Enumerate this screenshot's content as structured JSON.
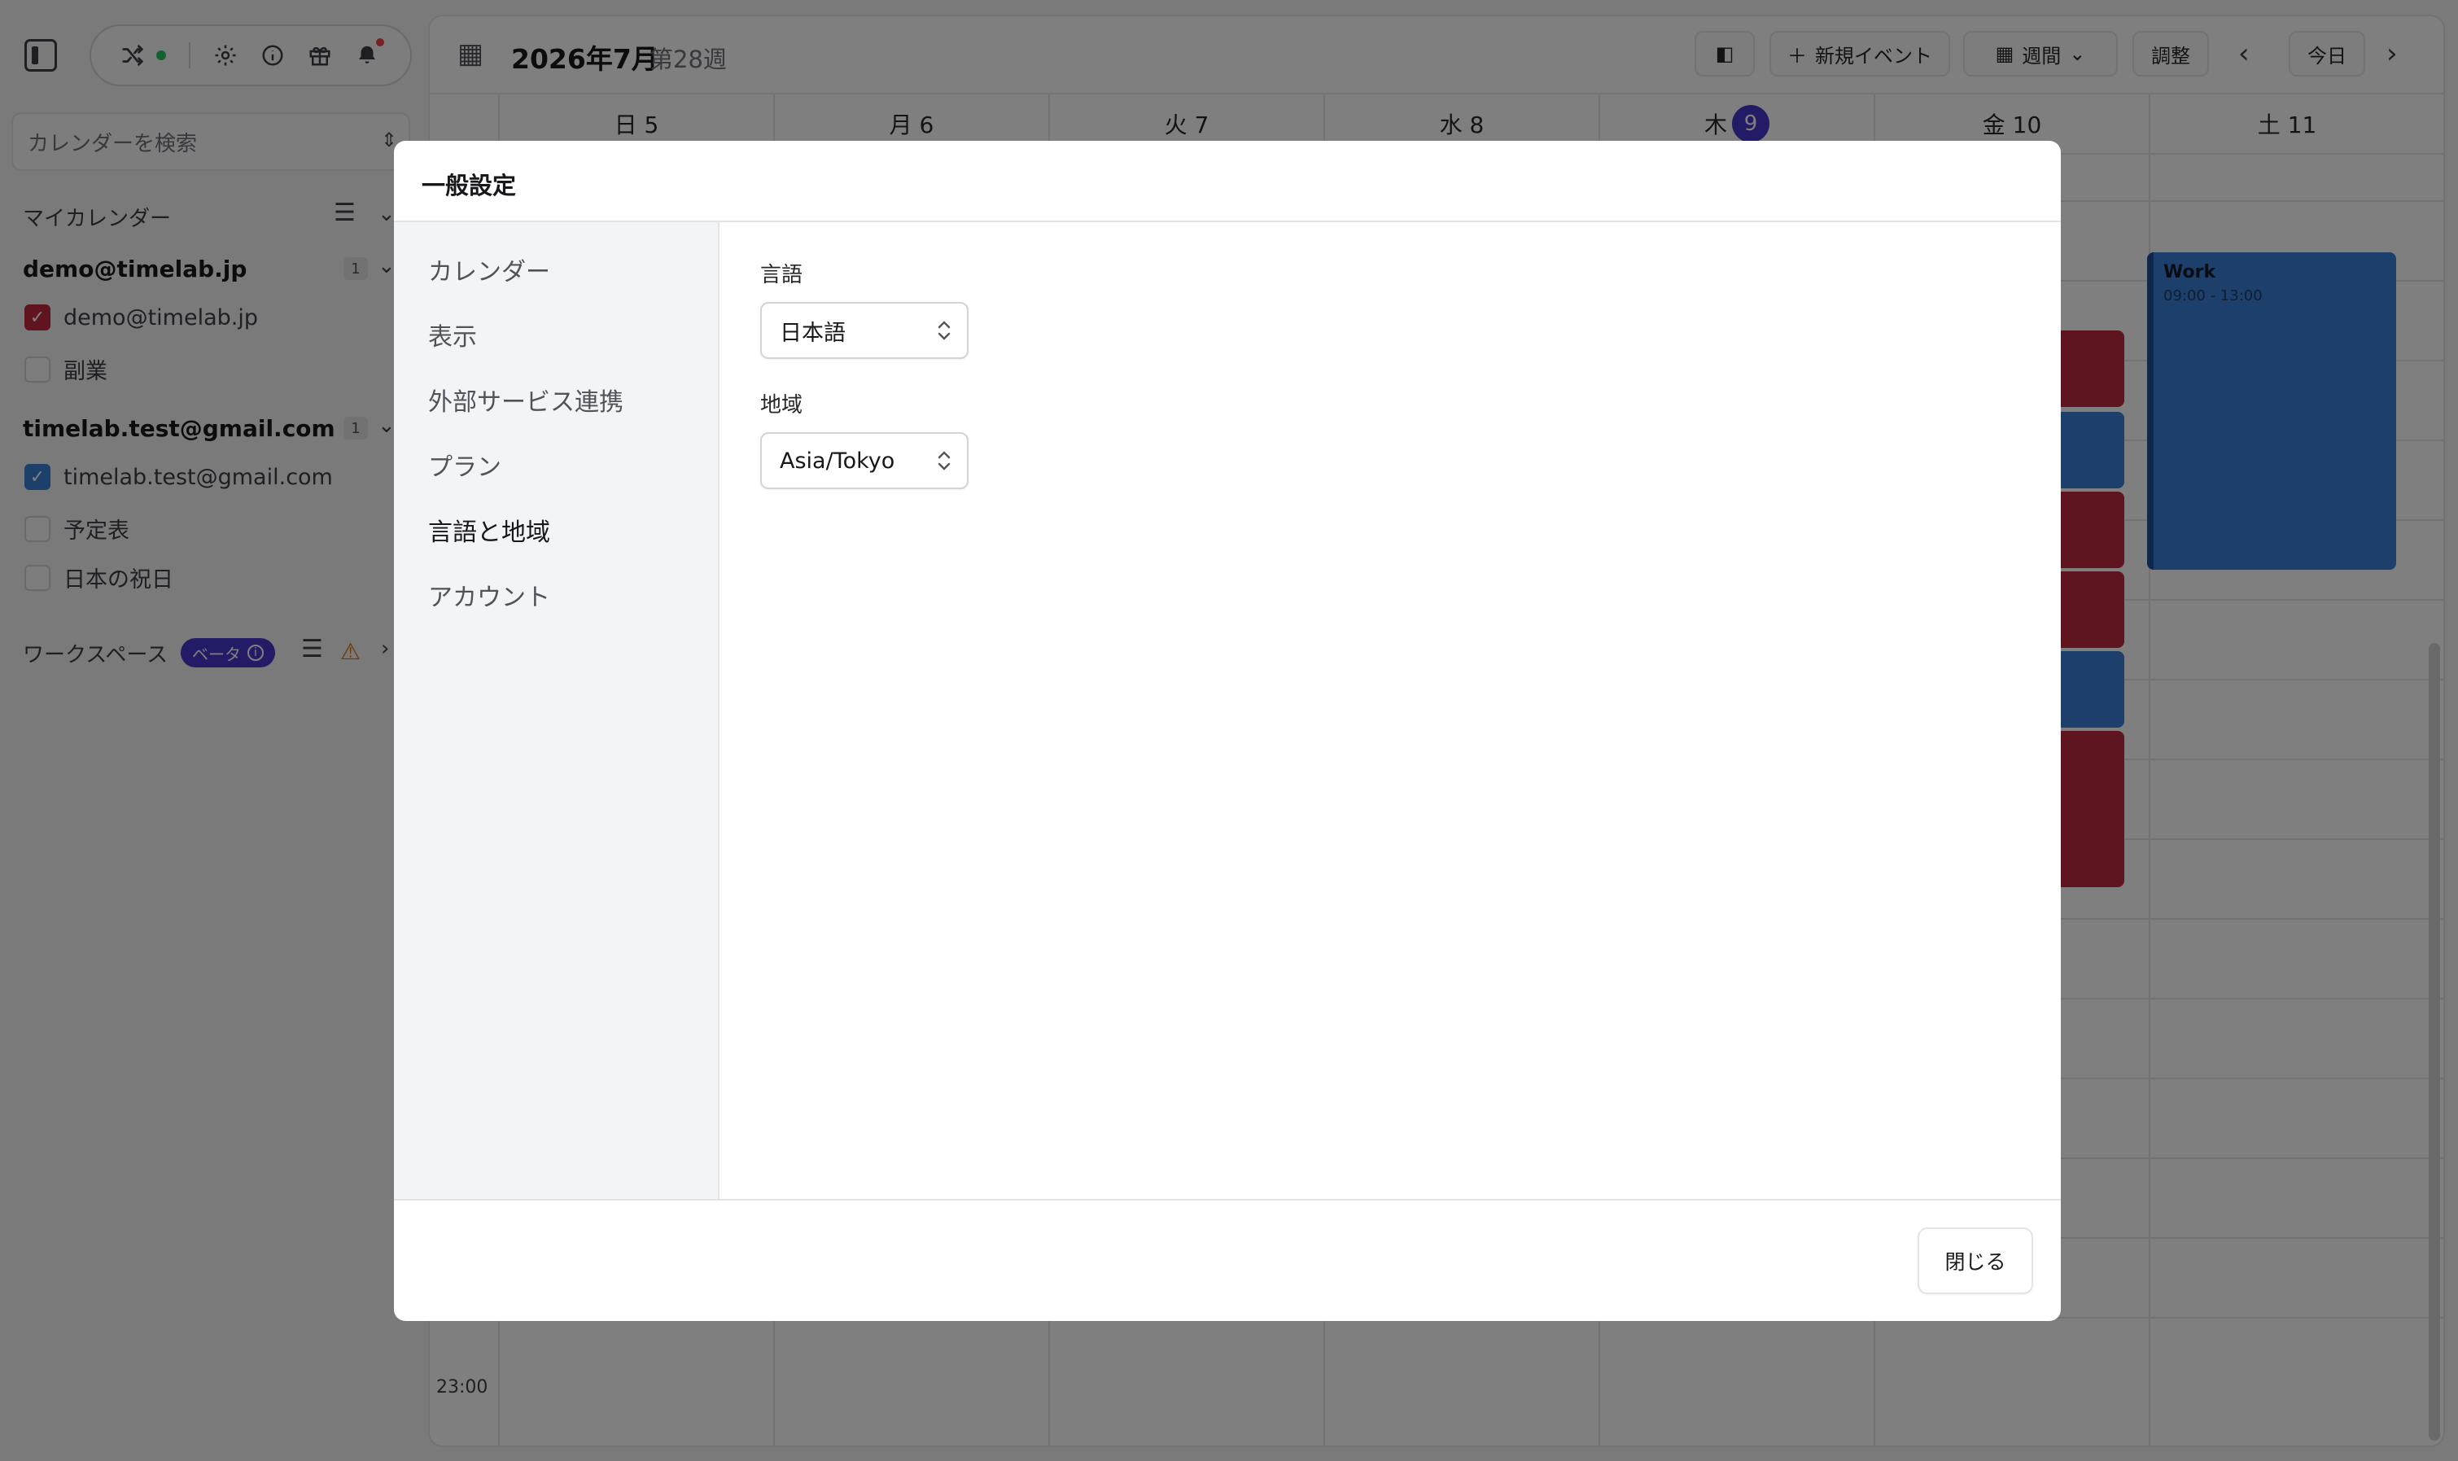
{
  "sidebar": {
    "search_placeholder": "カレンダーを検索",
    "my_calendars_title": "マイカレンダー",
    "accounts": [
      {
        "email": "demo@timelab.jp",
        "count": "1",
        "calendars": [
          {
            "name": "demo@timelab.jp",
            "checked": true,
            "color": "#c0283f"
          },
          {
            "name": "副業",
            "checked": false
          }
        ]
      },
      {
        "email": "timelab.test@gmail.com",
        "count": "1",
        "calendars": [
          {
            "name": "timelab.test@gmail.com",
            "checked": true,
            "color": "#3b7fd6"
          },
          {
            "name": "予定表",
            "checked": false
          },
          {
            "name": "日本の祝日",
            "checked": false
          }
        ]
      }
    ],
    "workspace_title": "ワークスペース",
    "beta_badge": "ベータ"
  },
  "calendar": {
    "title": "2026年7月",
    "week": "第28週",
    "buttons": {
      "new_event": "新規イベント",
      "view": "週間",
      "adjust": "調整",
      "today": "今日"
    },
    "days": [
      {
        "label": "日 5"
      },
      {
        "label": "月 6"
      },
      {
        "label": "火 7"
      },
      {
        "label": "水 8"
      },
      {
        "label": "木",
        "badge": "9"
      },
      {
        "label": "金 10"
      },
      {
        "label": "土 11"
      }
    ],
    "time_label": "23:00",
    "event": {
      "title": "Work",
      "time": "09:00 - 13:00"
    }
  },
  "dialog": {
    "title": "一般設定",
    "nav": [
      "カレンダー",
      "表示",
      "外部サービス連携",
      "プラン",
      "言語と地域",
      "アカウント"
    ],
    "active_nav": "言語と地域",
    "language_label": "言語",
    "language_value": "日本語",
    "region_label": "地域",
    "region_value": "Asia/Tokyo",
    "close_label": "閉じる"
  },
  "colors": {
    "accent": "#4338ca",
    "event_red": "#be2a3f",
    "event_blue": "#3b7fd6"
  }
}
